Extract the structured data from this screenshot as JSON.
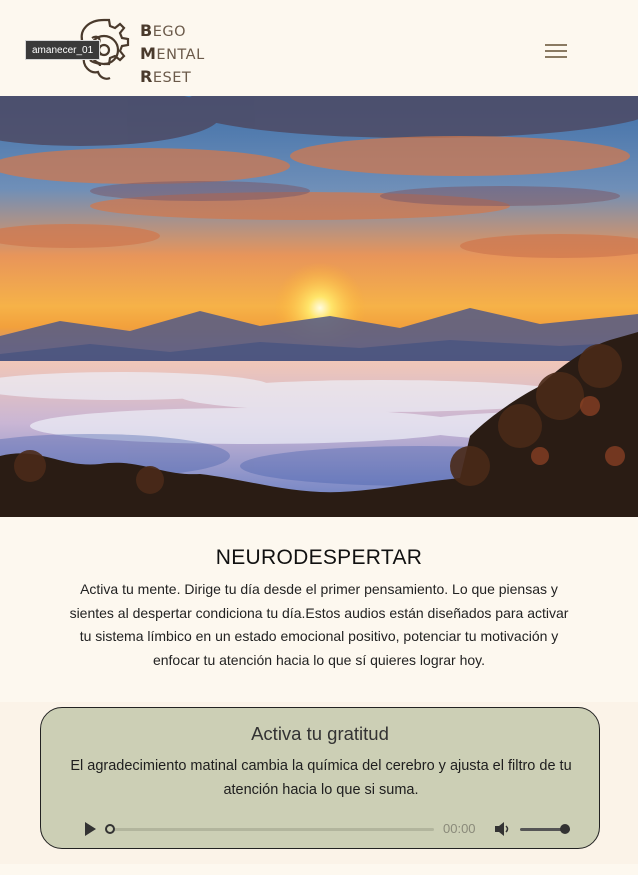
{
  "header": {
    "logo": {
      "line1_cap": "B",
      "line1_rest": "EGO",
      "line2_cap": "M",
      "line2_rest": "ENTAL",
      "line3_cap": "R",
      "line3_rest": "ESET"
    },
    "tooltip": "amanecer_01",
    "menu_icon": "hamburger-menu-icon"
  },
  "hero": {
    "alt": "sunrise-over-clouds-image"
  },
  "main": {
    "title": "NEURODESPERTAR",
    "intro": "Activa tu mente. Dirige tu día desde el primer pensamiento. Lo que piensas y sientes al despertar condiciona tu día.Estos audios están diseñados para activar tu sistema límbico en un estado emocional positivo, potenciar tu motivación y enfocar tu atención hacia lo que sí quieres lograr hoy."
  },
  "card": {
    "title": "Activa tu gratitud",
    "text": "El agradecimiento matinal cambia la química del cerebro y ajusta el filtro de tu atención hacia lo que si suma.",
    "player": {
      "time": "00:00",
      "progress": 0,
      "volume": 0.9
    }
  },
  "colors": {
    "background": "#fdf8ef",
    "card": "#cccfb5",
    "logo": "#6b5a4a",
    "menu": "#8a7a62"
  }
}
